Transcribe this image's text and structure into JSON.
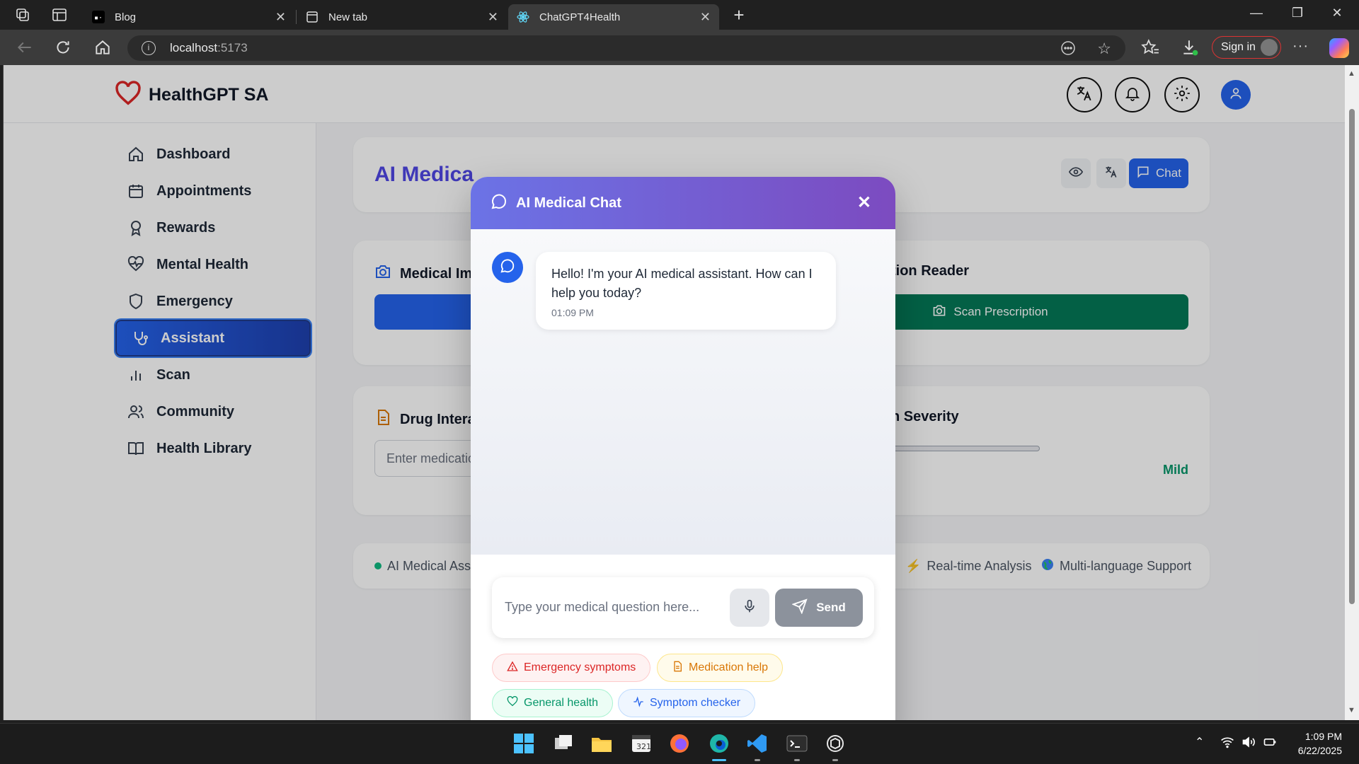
{
  "browser": {
    "tabs": [
      {
        "title": "Blog"
      },
      {
        "title": "New tab"
      },
      {
        "title": "ChatGPT4Health"
      }
    ],
    "url_host": "localhost",
    "url_port": ":5173",
    "signin_label": "Sign in"
  },
  "app": {
    "brand": "HealthGPT SA",
    "accent": "#2563eb",
    "sidebar": [
      {
        "label": "Dashboard",
        "icon": "home-icon"
      },
      {
        "label": "Appointments",
        "icon": "calendar-icon"
      },
      {
        "label": "Rewards",
        "icon": "award-icon"
      },
      {
        "label": "Mental Health",
        "icon": "heart-pulse-icon"
      },
      {
        "label": "Emergency",
        "icon": "shield-icon"
      },
      {
        "label": "Assistant",
        "icon": "stethoscope-icon",
        "active": true
      },
      {
        "label": "Scan",
        "icon": "bar-chart-icon"
      },
      {
        "label": "Community",
        "icon": "users-icon"
      },
      {
        "label": "Health Library",
        "icon": "book-icon"
      }
    ],
    "page_title": "AI Medica",
    "chat_button": "Chat",
    "cards": {
      "imaging_title": "Medical Im",
      "prescription_title": "tion Reader",
      "scan_prescription": "Scan Prescription",
      "drug_title": "Drug Intera",
      "drug_placeholder": "Enter medicatio",
      "severity_title": "n Severity",
      "severity_value": "Mild"
    },
    "features": [
      "AI Medical Ass",
      "Real-time Analysis",
      "Multi-language Support"
    ]
  },
  "chat": {
    "title": "AI Medical Chat",
    "message": "Hello! I'm your AI medical assistant. How can I help you today?",
    "time": "01:09 PM",
    "input_placeholder": "Type your medical question here...",
    "send_label": "Send",
    "chips": [
      "Emergency symptoms",
      "Medication help",
      "General health",
      "Symptom checker"
    ]
  },
  "taskbar": {
    "time": "1:09 PM",
    "date": "6/22/2025"
  }
}
